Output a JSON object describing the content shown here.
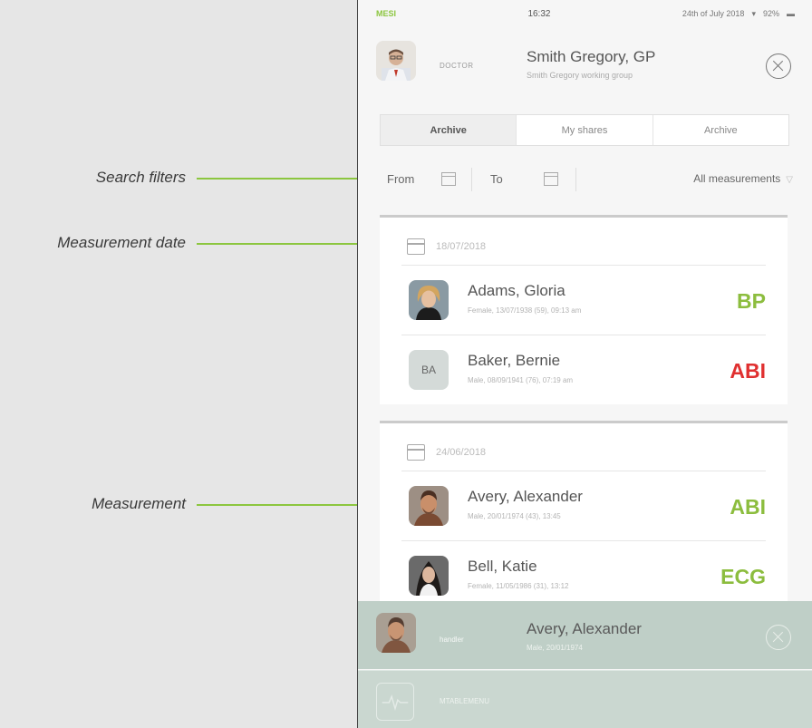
{
  "callouts": {
    "search_filters": "Search filters",
    "measurement_date": "Measurement date",
    "measurement": "Measurement"
  },
  "status_bar": {
    "brand": "MESI",
    "time": "16:32",
    "date": "24th of July 2018",
    "battery": "92%"
  },
  "doctor": {
    "role": "DOCTOR",
    "name": "Smith Gregory, GP",
    "group": "Smith Gregory working group"
  },
  "tabs": [
    "Archive",
    "My shares",
    "Archive"
  ],
  "filters": {
    "from_label": "From",
    "to_label": "To",
    "measurement_select": "All measurements"
  },
  "groups": [
    {
      "date": "18/07/2018",
      "patients": [
        {
          "name": "Adams, Gloria",
          "info": "Female, 13/07/1938 (59), 09:13 am",
          "type": "BP",
          "type_color": "#8cbd3e"
        },
        {
          "name": "Baker, Bernie",
          "initials": "BA",
          "info": "Male, 08/09/1941 (76), 07:19 am",
          "type": "ABI",
          "type_color": "#e03030"
        }
      ]
    },
    {
      "date": "24/06/2018",
      "patients": [
        {
          "name": "Avery, Alexander",
          "info": "Male, 20/01/1974 (43), 13:45",
          "type": "ABI",
          "type_color": "#8cbd3e"
        },
        {
          "name": "Bell, Katie",
          "info": "Female, 11/05/1986 (31), 13:12",
          "type": "ECG",
          "type_color": "#8cbd3e"
        }
      ]
    }
  ],
  "overlay": {
    "role": "handler",
    "name": "Avery, Alexander",
    "info": "Male, 20/01/1974"
  },
  "bottom": {
    "label": "MTABLEMENU",
    "icon": "heartbeat-icon"
  },
  "colors": {
    "accent": "#8cc63f",
    "ok": "#8cbd3e",
    "alert": "#e03030"
  }
}
